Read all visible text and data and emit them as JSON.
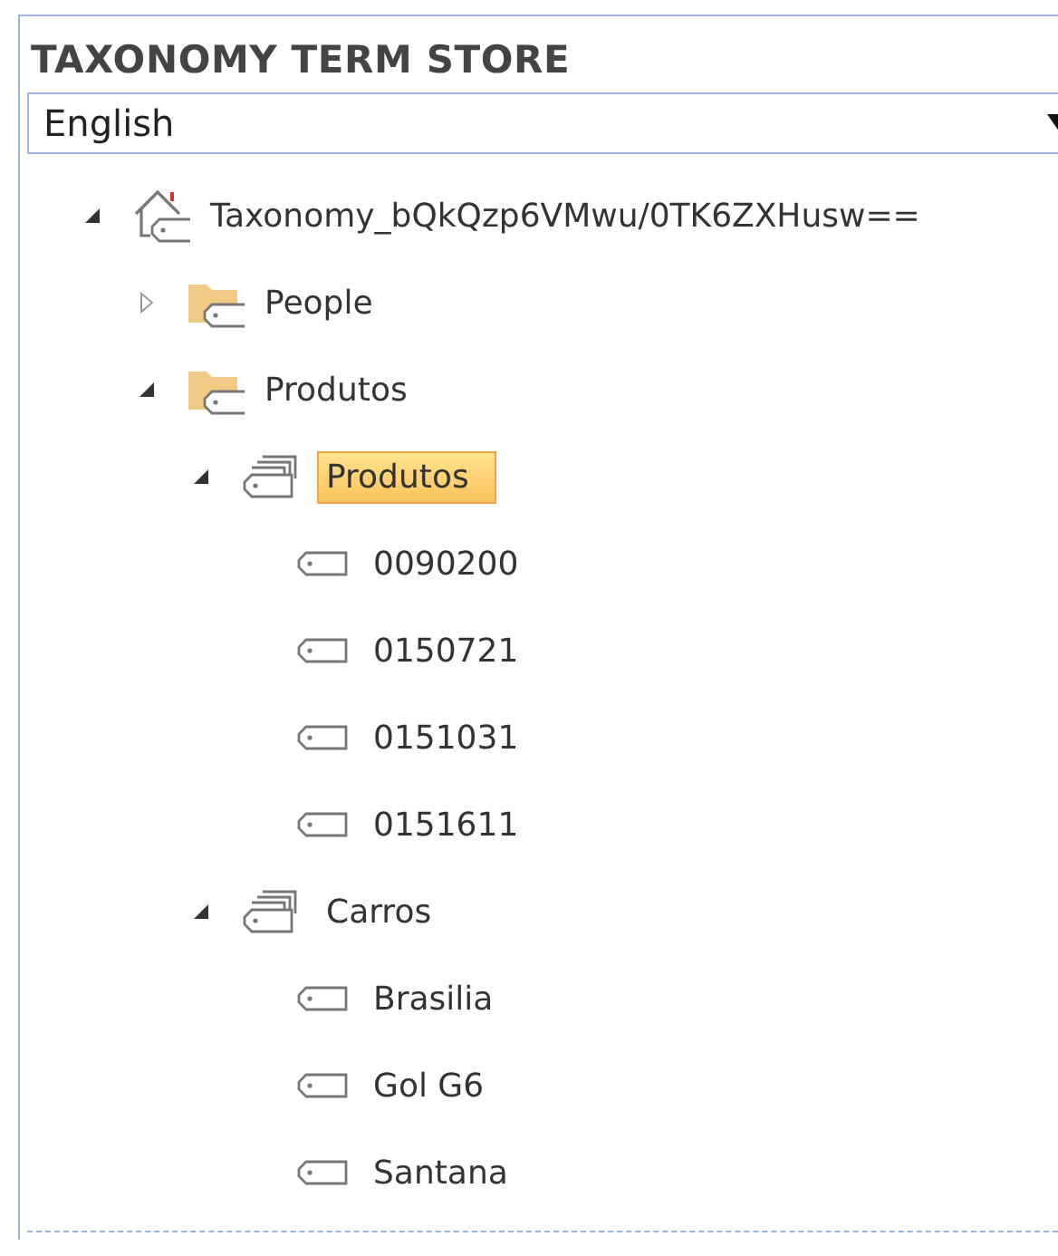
{
  "panel": {
    "title": "TAXONOMY TERM STORE",
    "language": {
      "value": "English"
    }
  },
  "tree": [
    {
      "kind": "store",
      "label": "Taxonomy_bQkQzp6VMwu/0TK6ZXHusw==",
      "expanded": true,
      "selected": false,
      "children": [
        {
          "kind": "group",
          "label": "People",
          "expanded": false,
          "selected": false
        },
        {
          "kind": "group",
          "label": "Produtos",
          "expanded": true,
          "selected": false,
          "children": [
            {
              "kind": "termset",
              "label": "Produtos",
              "expanded": true,
              "selected": true,
              "children": [
                {
                  "kind": "term",
                  "label": "0090200",
                  "selected": false
                },
                {
                  "kind": "term",
                  "label": "0150721",
                  "selected": false
                },
                {
                  "kind": "term",
                  "label": "0151031",
                  "selected": false
                },
                {
                  "kind": "term",
                  "label": "0151611",
                  "selected": false
                }
              ]
            },
            {
              "kind": "termset",
              "label": "Carros",
              "expanded": true,
              "selected": false,
              "children": [
                {
                  "kind": "term",
                  "label": "Brasilia",
                  "selected": false
                },
                {
                  "kind": "term",
                  "label": "Gol G6",
                  "selected": false
                },
                {
                  "kind": "term",
                  "label": "Santana",
                  "selected": false
                }
              ]
            }
          ]
        }
      ]
    }
  ]
}
